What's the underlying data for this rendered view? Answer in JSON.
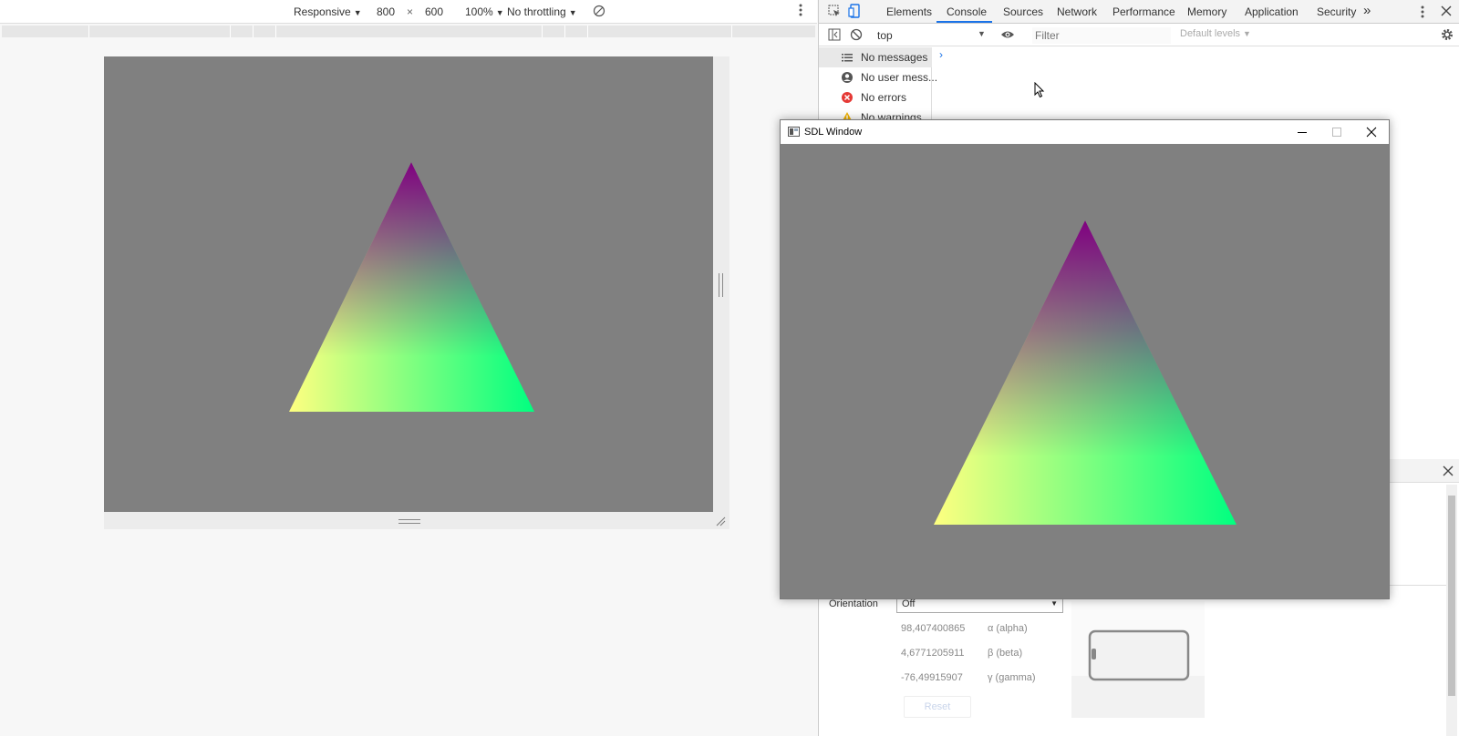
{
  "device_toolbar": {
    "mode": "Responsive",
    "width": "800",
    "times": "×",
    "height": "600",
    "zoom": "100%",
    "throttling": "No throttling"
  },
  "devtools": {
    "tabs": [
      "Elements",
      "Console",
      "Sources",
      "Network",
      "Performance",
      "Memory",
      "Application",
      "Security"
    ],
    "active_tab": "Console",
    "more_tabs": "»",
    "context": "top",
    "filter_placeholder": "Filter",
    "levels": "Default levels",
    "sidebar": [
      "No messages",
      "No user mess...",
      "No errors",
      "No warnings"
    ],
    "prompt": "›"
  },
  "sensors": {
    "orientation_label": "Orientation",
    "orientation_value": "Off",
    "alpha_value": "98,407400865",
    "alpha_label": "α (alpha)",
    "beta_value": "4,6771205911",
    "beta_label": "β (beta)",
    "gamma_value": "-76,49915907",
    "gamma_label": "γ (gamma)",
    "reset_label": "Reset"
  },
  "sdl_window": {
    "title": "SDL Window"
  },
  "colors": {
    "canvas_bg": "#808080",
    "vertex_top": "#800080",
    "vertex_left": "#ffff80",
    "vertex_right": "#00ff80",
    "accent": "#1a73e8"
  }
}
